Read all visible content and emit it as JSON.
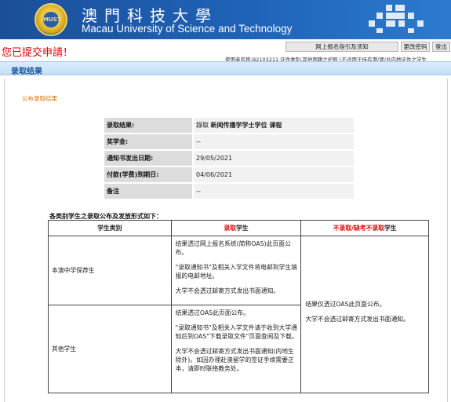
{
  "header": {
    "logo_text": "MUST",
    "university_zh": "澳門科技大學",
    "university_en": "Macau University of Science and Technology"
  },
  "toolbar": {
    "submitted_msg": "您已提交申請！",
    "guide_btn": "网上报名指引及须知",
    "change_pwd_btn": "更改密码",
    "logout_btn": "登出",
    "user_info": "使用者名称:B2103211   证件类别:其他国籍之护照 (不适用于持有港/澳/台内地证件之学生"
  },
  "section": {
    "title": "录取结果",
    "publish_title": "公布录取结果"
  },
  "result": {
    "rows": [
      {
        "label": "录取结果:",
        "prefix": "錄取",
        "value": "新闻传播学学士学位 课程"
      },
      {
        "label": "奖学金:",
        "prefix": "",
        "value": "--"
      },
      {
        "label": "通知书发出日期:",
        "prefix": "",
        "value": "29/05/2021"
      },
      {
        "label": "付款(学费)到期日:",
        "prefix": "",
        "value": "04/06/2021"
      },
      {
        "label": "备注",
        "prefix": "",
        "value": "--"
      }
    ]
  },
  "rules": {
    "caption": "各类别学生之录取公布及发放形式如下：",
    "headers": {
      "category": "学生类别",
      "admitted_red": "录取",
      "admitted_rest": "学生",
      "rejected_red": "不录取/缺考不录取",
      "rejected_rest": "学生"
    },
    "rows": [
      {
        "category": "本澳中学保荐生",
        "admitted": [
          "结果透过网上报名系统(简称OAS)此页面公布。",
          "\"录取通知书\"及相关入学文件将电邮到学生填报的电邮地址。",
          "大学不会透过邮寄方式发出书面通知。"
        ]
      },
      {
        "category": "其他学生",
        "admitted": [
          "结果透过OAS此页面公布。",
          "\"录取通知书\"及相关入学文件请于收到大学通知后到OAS\"下载录取文件\"页面查阅及下载。",
          "大学不会透过邮寄方式发出书面通知(内地生除外)。如因办理赴澳留学的签证手续需要正本，请即时联络教务处。"
        ]
      }
    ],
    "rejected": [
      "结果仅透过OAS此页面公布。",
      "大学不会透过邮寄方式发出书面通知。"
    ]
  }
}
